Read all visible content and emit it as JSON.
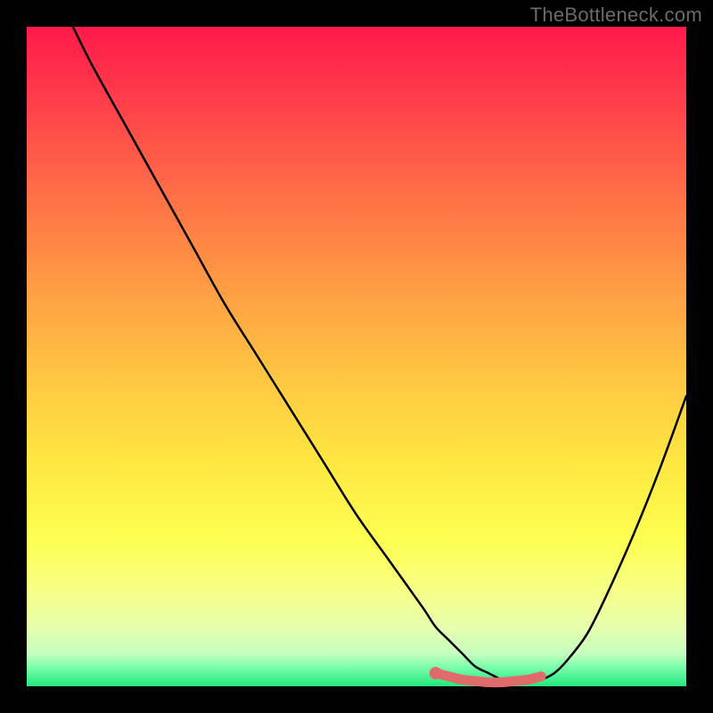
{
  "watermark": "TheBottleneck.com",
  "chart_data": {
    "type": "line",
    "title": "",
    "xlabel": "",
    "ylabel": "",
    "xlim": [
      0,
      100
    ],
    "ylim": [
      0,
      100
    ],
    "x": [
      7,
      10,
      15,
      20,
      25,
      30,
      35,
      40,
      45,
      50,
      55,
      60,
      62,
      64,
      66,
      68,
      70,
      72,
      74,
      76,
      78,
      80,
      82,
      85,
      88,
      92,
      96,
      100
    ],
    "values": [
      100,
      94,
      85,
      76,
      67,
      58,
      50,
      42,
      34,
      26,
      19,
      12,
      9,
      7,
      5,
      3,
      2,
      1,
      0.5,
      0.5,
      1,
      2,
      4,
      8,
      14,
      23,
      33,
      44
    ],
    "highlight_segment": {
      "x": [
        62,
        64,
        66,
        68,
        70,
        72,
        74,
        76,
        78
      ],
      "values": [
        2,
        1.5,
        1,
        0.8,
        0.6,
        0.6,
        0.8,
        1,
        1.5
      ],
      "color": "#e16a6a"
    },
    "gradient_stops": [
      {
        "pos": 0,
        "color": "#ff1a4b"
      },
      {
        "pos": 50,
        "color": "#ffc342"
      },
      {
        "pos": 80,
        "color": "#fdff52"
      },
      {
        "pos": 100,
        "color": "#22e77e"
      }
    ]
  }
}
